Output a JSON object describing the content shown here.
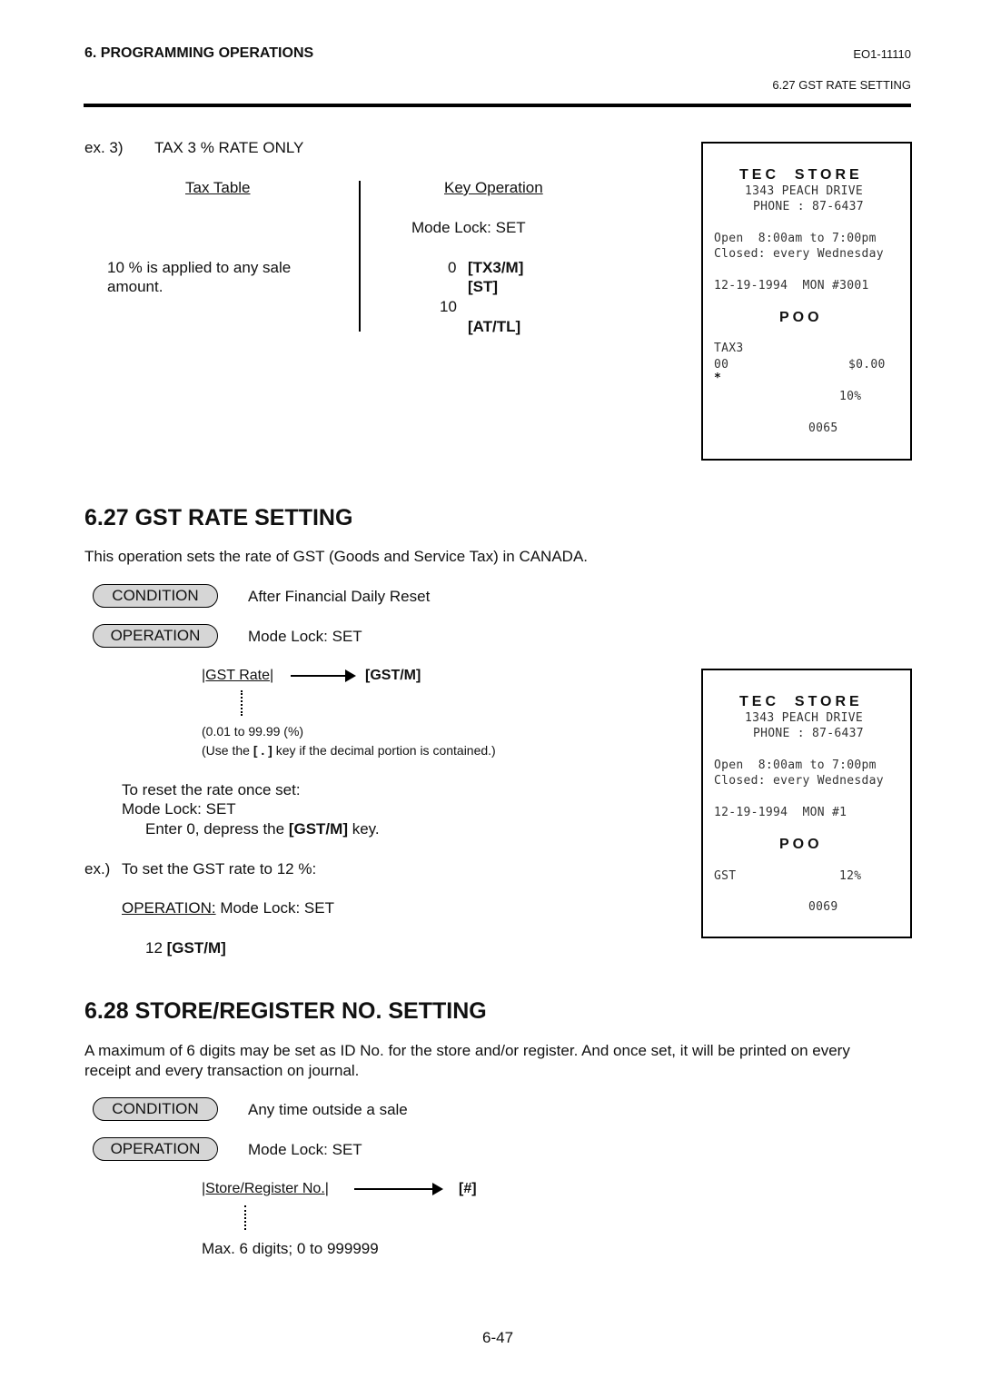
{
  "header": {
    "chapter": "6.   PROGRAMMING OPERATIONS",
    "doc_code": "EO1-11110",
    "section_ref": "6.27  GST RATE SETTING"
  },
  "example3": {
    "label": "ex. 3)",
    "title": "TAX 3 % RATE ONLY",
    "tax_table_heading": "Tax Table",
    "key_operation_heading": "Key Operation",
    "tax_table_line1": "10 % is applied to any sale",
    "tax_table_line2": "amount.",
    "mode_lock": "Mode Lock:  SET",
    "keys": [
      {
        "num": "0",
        "key": "[TX3/M]"
      },
      {
        "num": "",
        "key": "[ST]"
      },
      {
        "num": "10",
        "key": ""
      },
      {
        "num": "",
        "key": "[AT/TL]"
      }
    ]
  },
  "receipt1": {
    "store": "TEC  STORE",
    "address": "1343 PEACH DRIVE",
    "phone": "PHONE : 87-6437",
    "hours": "Open  8:00am to 7:00pm",
    "closed": "Closed: every Wednesday",
    "date_line": "12-19-1994  MON #3001",
    "mode": "POO",
    "tax_label": "TAX3",
    "amount_left": "00",
    "amount_right": "$0.00",
    "star": "*",
    "rate": "10%",
    "consecutive": "0065"
  },
  "section627": {
    "title": "6.27   GST RATE SETTING",
    "description": "This operation sets the rate of GST (Goods and Service Tax) in CANADA.",
    "condition_label": "CONDITION",
    "condition_text": "After Financial Daily Reset",
    "operation_label": "OPERATION",
    "operation_text": "Mode Lock:  SET",
    "flow_input": "|GST Rate|",
    "flow_key": "[GST/M]",
    "range_note": "(0.01 to 99.99 (%)",
    "decimal_note_pre": "(Use the ",
    "decimal_note_key": "[ . ]",
    "decimal_note_post": " key if the decimal portion is contained.)",
    "reset_line1": "To reset the rate once set:",
    "reset_line2": "Mode Lock:  SET",
    "reset_line3_pre": "Enter 0, depress the ",
    "reset_line3_key": "[GST/M]",
    "reset_line3_post": " key.",
    "ex_label": "ex.)",
    "ex_text": "To set the GST rate to 12 %:",
    "ex_operation_label": "OPERATION:",
    "ex_operation_text": " Mode Lock:  SET",
    "ex_key_num": "12 ",
    "ex_key": "[GST/M]"
  },
  "receipt2": {
    "store": "TEC  STORE",
    "address": "1343 PEACH DRIVE",
    "phone": "PHONE : 87-6437",
    "hours": "Open  8:00am to 7:00pm",
    "closed": "Closed: every Wednesday",
    "date_line": "12-19-1994  MON #1",
    "mode": "POO",
    "gst_label": "GST",
    "gst_rate": "12%",
    "consecutive": "0069"
  },
  "section628": {
    "title": "6.28   STORE/REGISTER NO. SETTING",
    "description_line1": "A maximum of 6 digits may be set as ID No. for the store and/or register. And once set, it will be printed on every",
    "description_line2": "receipt and every transaction on journal.",
    "condition_label": "CONDITION",
    "condition_text": "Any time outside a sale",
    "operation_label": "OPERATION",
    "operation_text": "Mode Lock:  SET",
    "flow_input": "|Store/Register No.|",
    "flow_key": "[#]",
    "range_note": "Max. 6 digits;  0 to 999999"
  },
  "footer": {
    "page_number": "6-47"
  }
}
